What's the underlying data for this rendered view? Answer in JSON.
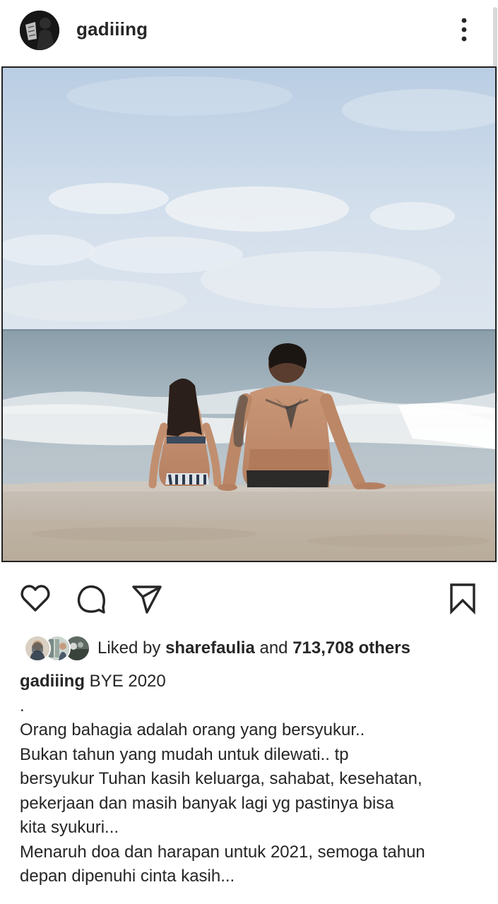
{
  "post": {
    "username": "gadiiing",
    "likes": {
      "prefix": "Liked by",
      "liker": "sharefaulia",
      "connector": "and",
      "others": "713,708 others"
    },
    "caption": {
      "username": "gadiiing",
      "lines": [
        "BYE 2020",
        ".",
        "Orang bahagia adalah orang yang bersyukur..",
        "Bukan tahun yang mudah untuk dilewati.. tp",
        "bersyukur Tuhan kasih keluarga, sahabat, kesehatan,",
        "pekerjaan dan masih banyak lagi yg pastinya bisa",
        "kita syukuri...",
        "Menaruh doa dan harapan untuk 2021, semoga tahun",
        "depan dipenuhi cinta kasih..."
      ]
    }
  },
  "icons": {
    "more": "more-vertical-icon",
    "like": "heart-icon",
    "comment": "comment-icon",
    "share": "share-icon",
    "save": "bookmark-icon"
  }
}
